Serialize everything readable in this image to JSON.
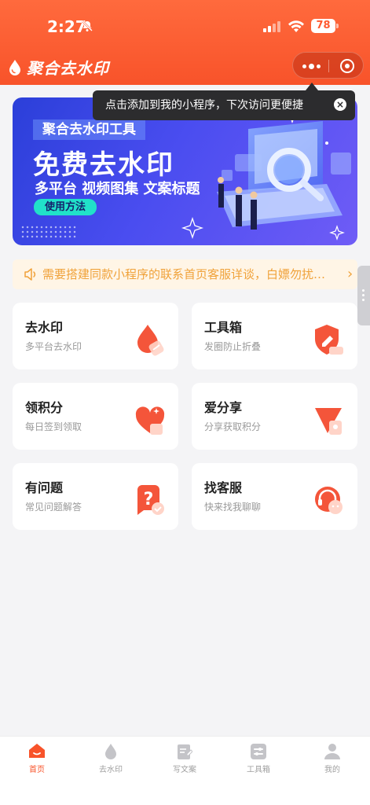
{
  "status": {
    "time": "2:27",
    "battery": "78"
  },
  "header": {
    "title": "聚合去水印"
  },
  "tooltip": {
    "text": "点击添加到我的小程序，下次访问更便捷",
    "close": "×"
  },
  "banner": {
    "kicker": "聚合去水印工具",
    "headline": "免费去水印",
    "subline": "多平台 视频图集 文案标题",
    "button": "使用方法"
  },
  "notice": {
    "text": "需要搭建同款小程序的联系首页客服详谈，白嫖勿扰…"
  },
  "cards": [
    {
      "title": "去水印",
      "subtitle": "多平台去水印",
      "icon": "droplet-icon"
    },
    {
      "title": "工具箱",
      "subtitle": "发圈防止折叠",
      "icon": "shield-pencil-icon"
    },
    {
      "title": "领积分",
      "subtitle": "每日签到领取",
      "icon": "heart-icon"
    },
    {
      "title": "爱分享",
      "subtitle": "分享获取积分",
      "icon": "share-icon"
    },
    {
      "title": "有问题",
      "subtitle": "常见问题解答",
      "icon": "question-icon"
    },
    {
      "title": "找客服",
      "subtitle": "快来找我聊聊",
      "icon": "headset-icon"
    }
  ],
  "tabbar": [
    {
      "label": "首页",
      "icon": "home-icon",
      "active": true
    },
    {
      "label": "去水印",
      "icon": "droplet-icon",
      "active": false
    },
    {
      "label": "写文案",
      "icon": "document-edit-icon",
      "active": false
    },
    {
      "label": "工具箱",
      "icon": "toolbox-icon",
      "active": false
    },
    {
      "label": "我的",
      "icon": "user-icon",
      "active": false
    }
  ],
  "colors": {
    "brand": "#f8532a",
    "banner": "#3d46e6",
    "notice": "#f0a23a",
    "accent": "#21e1c9"
  }
}
